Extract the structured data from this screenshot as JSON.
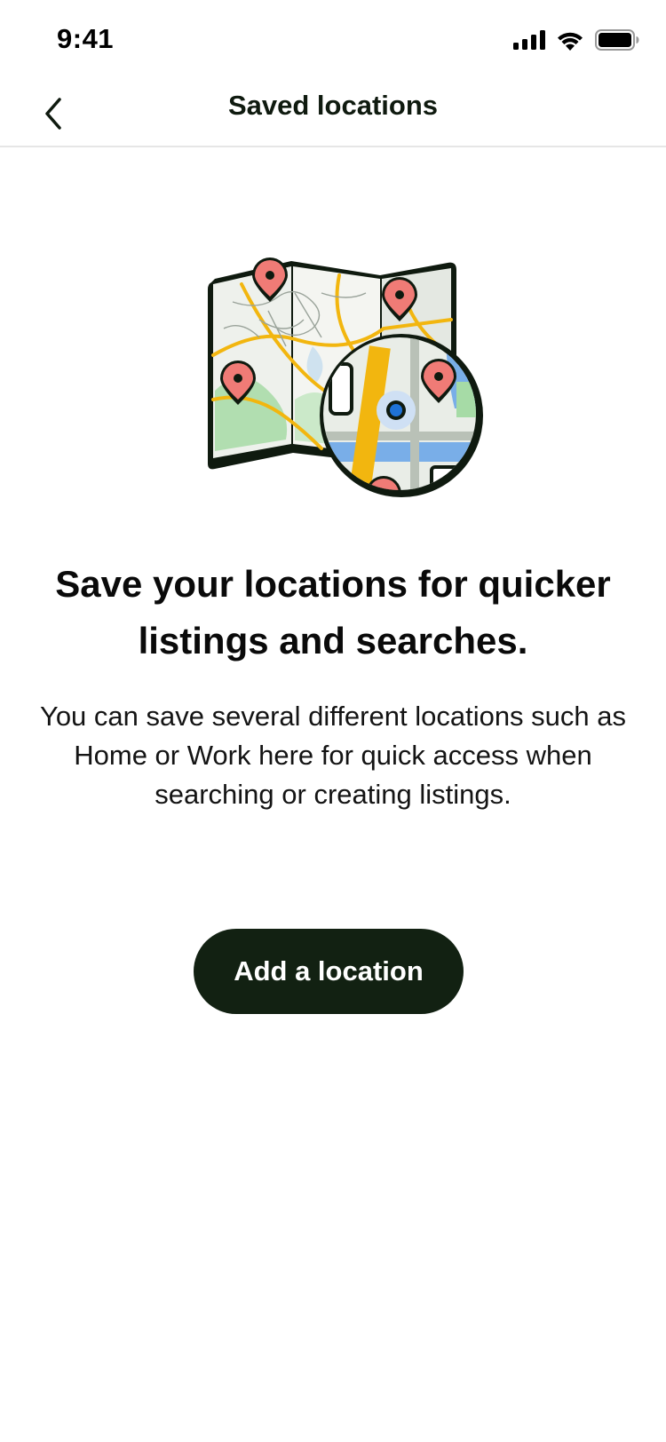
{
  "status_bar": {
    "time": "9:41",
    "icons": [
      "cellular-signal-icon",
      "wifi-icon",
      "battery-icon"
    ]
  },
  "nav": {
    "back_icon": "chevron-left-icon",
    "title": "Saved locations"
  },
  "illustration": {
    "name": "map-with-location-pins-illustration",
    "colors": {
      "pin": "#f07b76",
      "road": "#f2b60f",
      "water": "#79aee8",
      "park": "#a6dba6",
      "outline": "#0f1a0f"
    }
  },
  "content": {
    "headline": "Save your locations for quicker listings and searches.",
    "body": "You can save several different locations such as Home or Work here for quick access when searching or creating listings."
  },
  "actions": {
    "add_location_label": "Add a location"
  },
  "colors": {
    "button_bg": "#122112",
    "button_text": "#ffffff",
    "divider": "#e6e6e6"
  }
}
